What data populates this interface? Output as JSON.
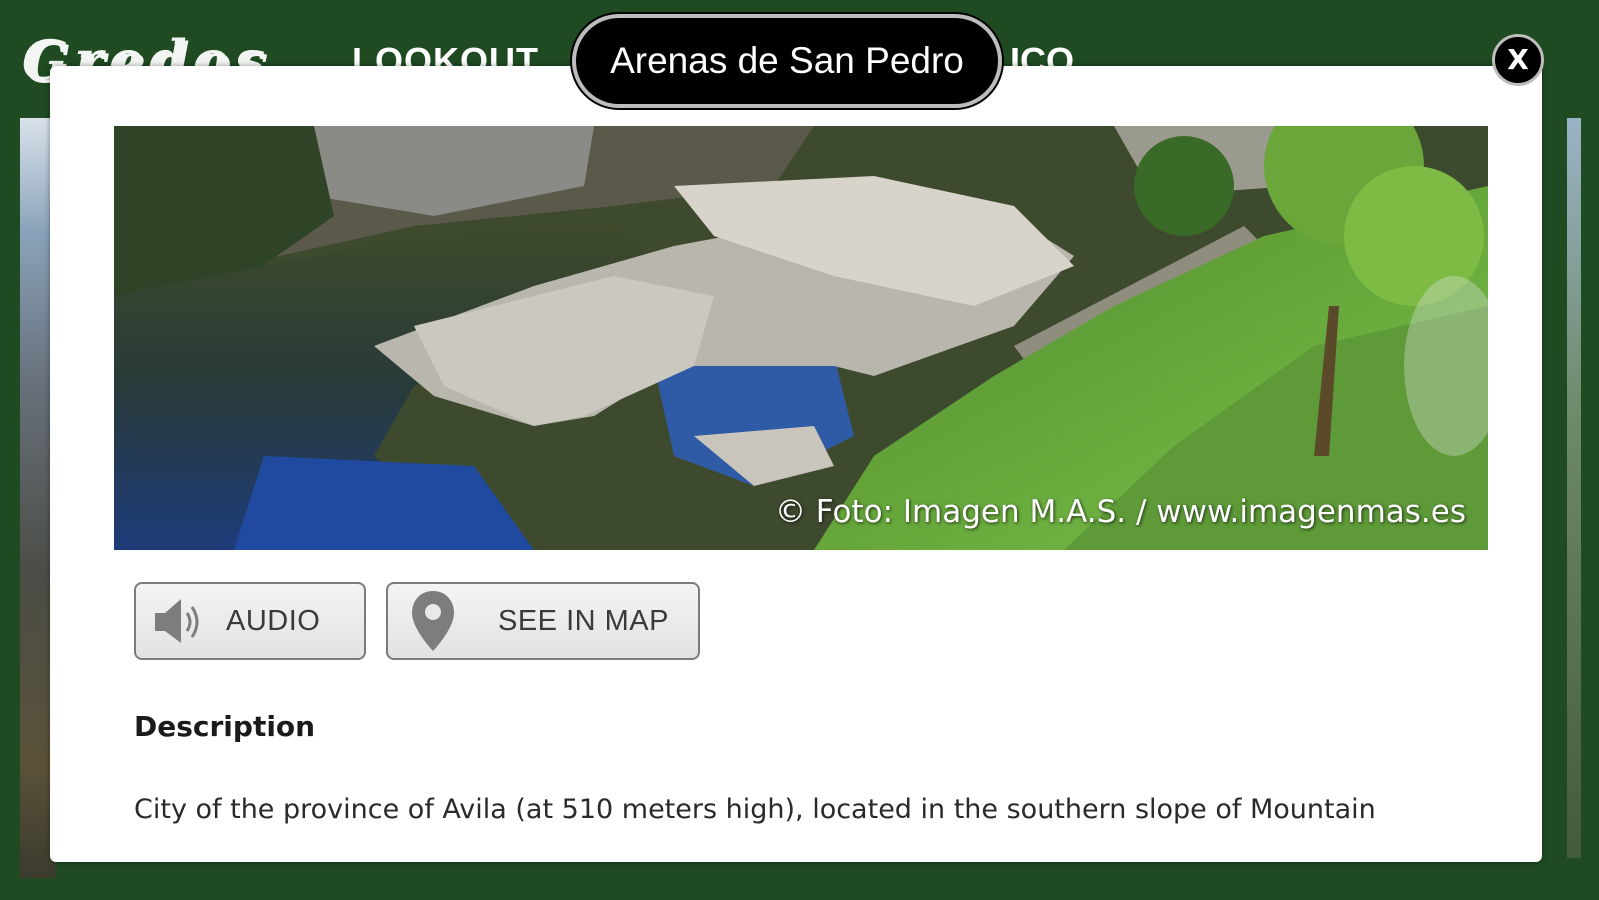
{
  "header": {
    "logo_text": "Gredos",
    "title_left": "LOOKOUT",
    "title_right": "ICO"
  },
  "modal": {
    "title": "Arenas de San Pedro",
    "close_label": "X",
    "photo_credit": "© Foto: Imagen M.A.S. / www.imagenmas.es",
    "buttons": {
      "audio_label": "AUDIO",
      "map_label": "SEE IN MAP"
    },
    "description_heading": "Description",
    "description_text": "City of the province of Avila (at 510 meters high), located in the southern slope of Mountain"
  },
  "icons": {
    "audio": "speaker-icon",
    "map": "map-pin-icon",
    "close": "close-icon"
  },
  "colors": {
    "frame_green": "#1f4a22",
    "pill_bg": "#000000",
    "button_bg": "#e9e9e9"
  }
}
